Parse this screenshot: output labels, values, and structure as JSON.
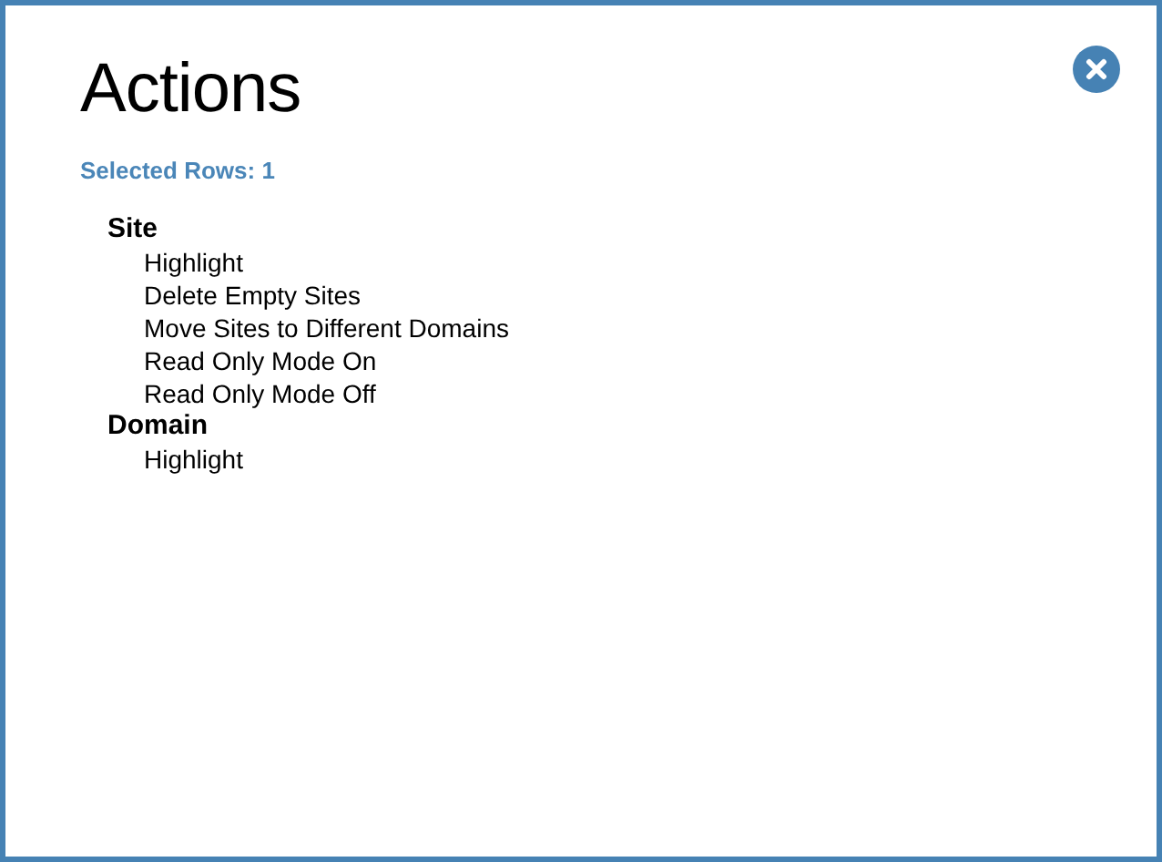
{
  "dialog": {
    "title": "Actions",
    "selection_info": "Selected Rows: 1"
  },
  "action_groups": [
    {
      "label": "Site",
      "children": [
        {
          "label": "Highlight"
        },
        {
          "label": "Delete Empty Sites"
        },
        {
          "label": "Move Sites to Different Domains"
        },
        {
          "label": "Read Only Mode On"
        },
        {
          "label": "Read Only Mode Off"
        }
      ]
    },
    {
      "label": "Domain",
      "children": [
        {
          "label": "Highlight"
        }
      ]
    }
  ]
}
